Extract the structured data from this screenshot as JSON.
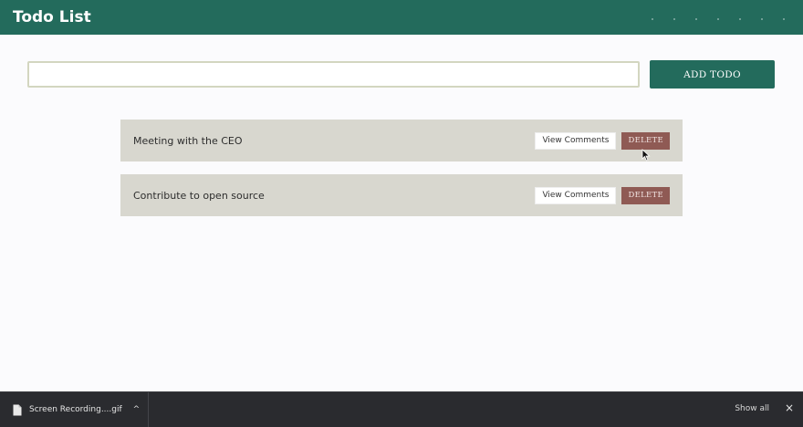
{
  "header": {
    "title": "Todo List"
  },
  "form": {
    "input_value": "",
    "add_button_label": "ADD TODO"
  },
  "todos": [
    {
      "text": "Meeting with the CEO",
      "view_label": "View Comments",
      "delete_label": "DELETE"
    },
    {
      "text": "Contribute to open source",
      "view_label": "View Comments",
      "delete_label": "DELETE"
    }
  ],
  "download_bar": {
    "file_name": "Screen Recording....gif",
    "show_all_label": "Show all",
    "close_glyph": "×",
    "chevron_glyph": "^"
  },
  "colors": {
    "header": "#236b5c",
    "todo_background": "#d8d7cf",
    "delete_button": "#8f5a54"
  },
  "icons": [
    "cursor-icon",
    "file-icon",
    "chevron-up-icon",
    "close-icon"
  ]
}
